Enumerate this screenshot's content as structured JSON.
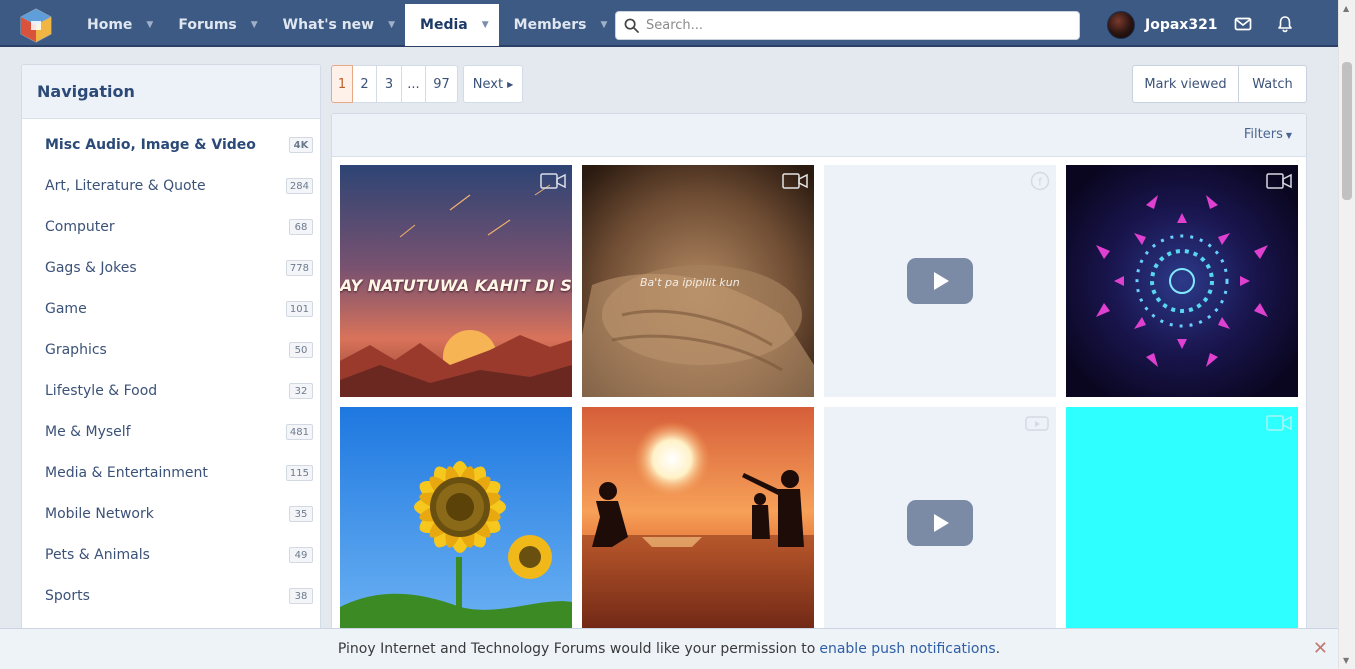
{
  "nav": {
    "tabs": [
      {
        "label": "Home"
      },
      {
        "label": "Forums"
      },
      {
        "label": "What's new"
      },
      {
        "label": "Media"
      },
      {
        "label": "Members"
      }
    ],
    "search_placeholder": "Search...",
    "username": "Jopax321"
  },
  "sidebar": {
    "title": "Navigation",
    "items": [
      {
        "label": "Misc Audio, Image & Video",
        "count": "4K"
      },
      {
        "label": "Art, Literature & Quote",
        "count": "284"
      },
      {
        "label": "Computer",
        "count": "68"
      },
      {
        "label": "Gags & Jokes",
        "count": "778"
      },
      {
        "label": "Game",
        "count": "101"
      },
      {
        "label": "Graphics",
        "count": "50"
      },
      {
        "label": "Lifestyle & Food",
        "count": "32"
      },
      {
        "label": "Me & Myself",
        "count": "481"
      },
      {
        "label": "Media & Entertainment",
        "count": "115"
      },
      {
        "label": "Mobile Network",
        "count": "35"
      },
      {
        "label": "Pets & Animals",
        "count": "49"
      },
      {
        "label": "Sports",
        "count": "38"
      }
    ]
  },
  "pagination": {
    "pages": [
      "1",
      "2",
      "3",
      "...",
      "97"
    ],
    "next_label": "Next"
  },
  "actions": {
    "mark_viewed": "Mark viewed",
    "watch": "Watch"
  },
  "media": {
    "filters_label": "Filters",
    "tile1_text": "AY NATUTUWA KAHIT DI SINA",
    "tile2_text": "Ba't pa ipipilit kun"
  },
  "notice": {
    "text": "Pinoy Internet and Technology Forums would like your permission to",
    "link": "enable push notifications",
    "suffix": "."
  },
  "colors": {
    "header": "#3d5a84",
    "accent_link": "#2f5fa3",
    "cyan_tile": "#2effff"
  }
}
